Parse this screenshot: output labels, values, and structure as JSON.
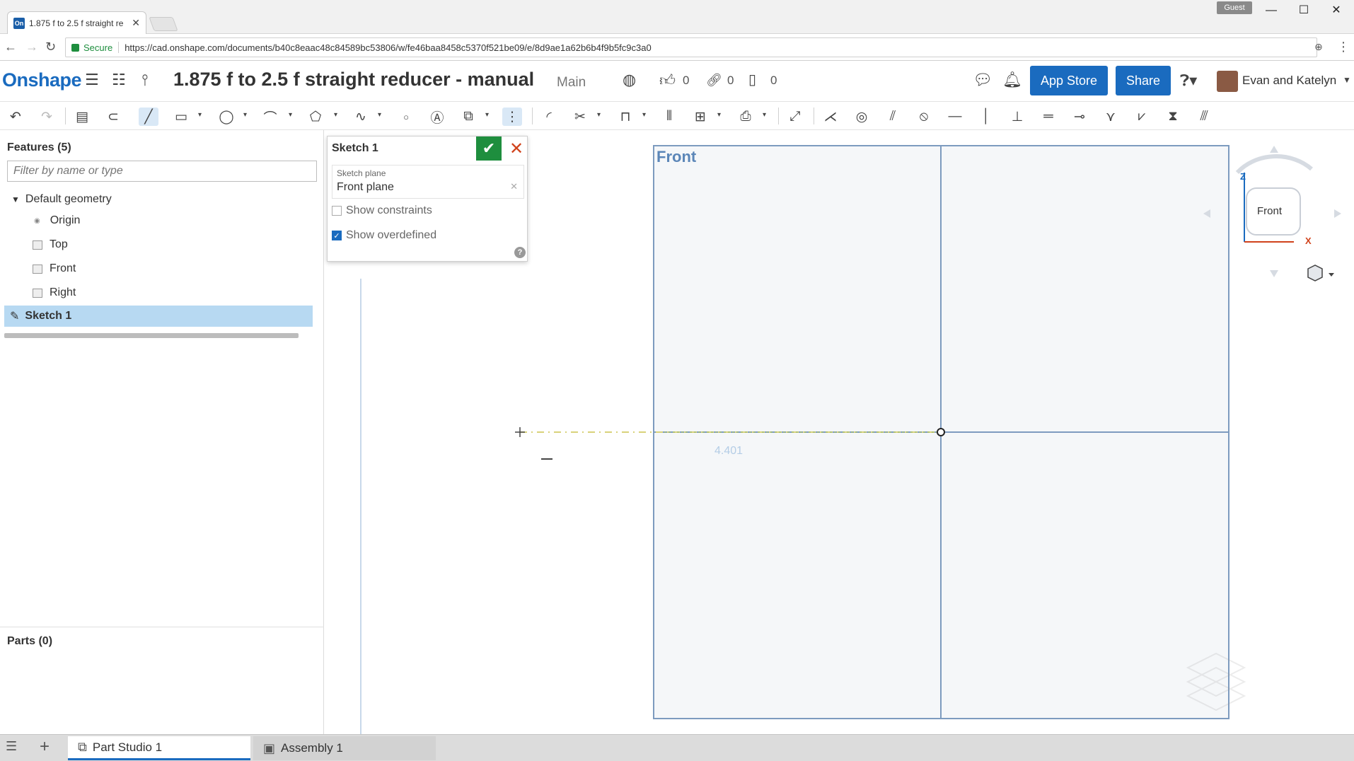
{
  "browser": {
    "tab_title": "1.875 f to 2.5 f straight re",
    "tab_favicon": "On",
    "guest_label": "Guest",
    "secure_label": "Secure",
    "url": "https://cad.onshape.com/documents/b40c8eaac48c84589bc53806/w/fe46baa8458c5370f521be09/e/8d9ae1a62b6b4f9b5fc9c3a0"
  },
  "header": {
    "logo": "Onshape",
    "document_title": "1.875 f to 2.5 f straight reducer - manual",
    "branch": "Main",
    "likes_count": "0",
    "links_count": "0",
    "copies_count": "0",
    "app_store_label": "App Store",
    "share_label": "Share",
    "user_name": "Evan and Katelyn"
  },
  "features": {
    "heading": "Features (5)",
    "filter_placeholder": "Filter by name or type",
    "default_geometry": "Default geometry",
    "origin": "Origin",
    "top": "Top",
    "front": "Front",
    "right": "Right",
    "sketch": "Sketch 1",
    "parts_heading": "Parts (0)"
  },
  "dialog": {
    "title": "Sketch 1",
    "plane_label": "Sketch plane",
    "plane_value": "Front plane",
    "show_constraints": "Show constraints",
    "show_overdefined": "Show overdefined",
    "show_constraints_checked": false,
    "show_overdefined_checked": true
  },
  "canvas": {
    "plane_label": "Front",
    "dimension_text": "4.401",
    "view_cube_label": "Front",
    "axis_z": "Z",
    "axis_x": "X"
  },
  "bottom_tabs": {
    "part_studio": "Part Studio 1",
    "assembly": "Assembly 1"
  },
  "colors": {
    "accent": "#1a6bbf",
    "confirm": "#1e8e3e",
    "cancel": "#d0421b",
    "plane_line": "#7d9bbf"
  }
}
